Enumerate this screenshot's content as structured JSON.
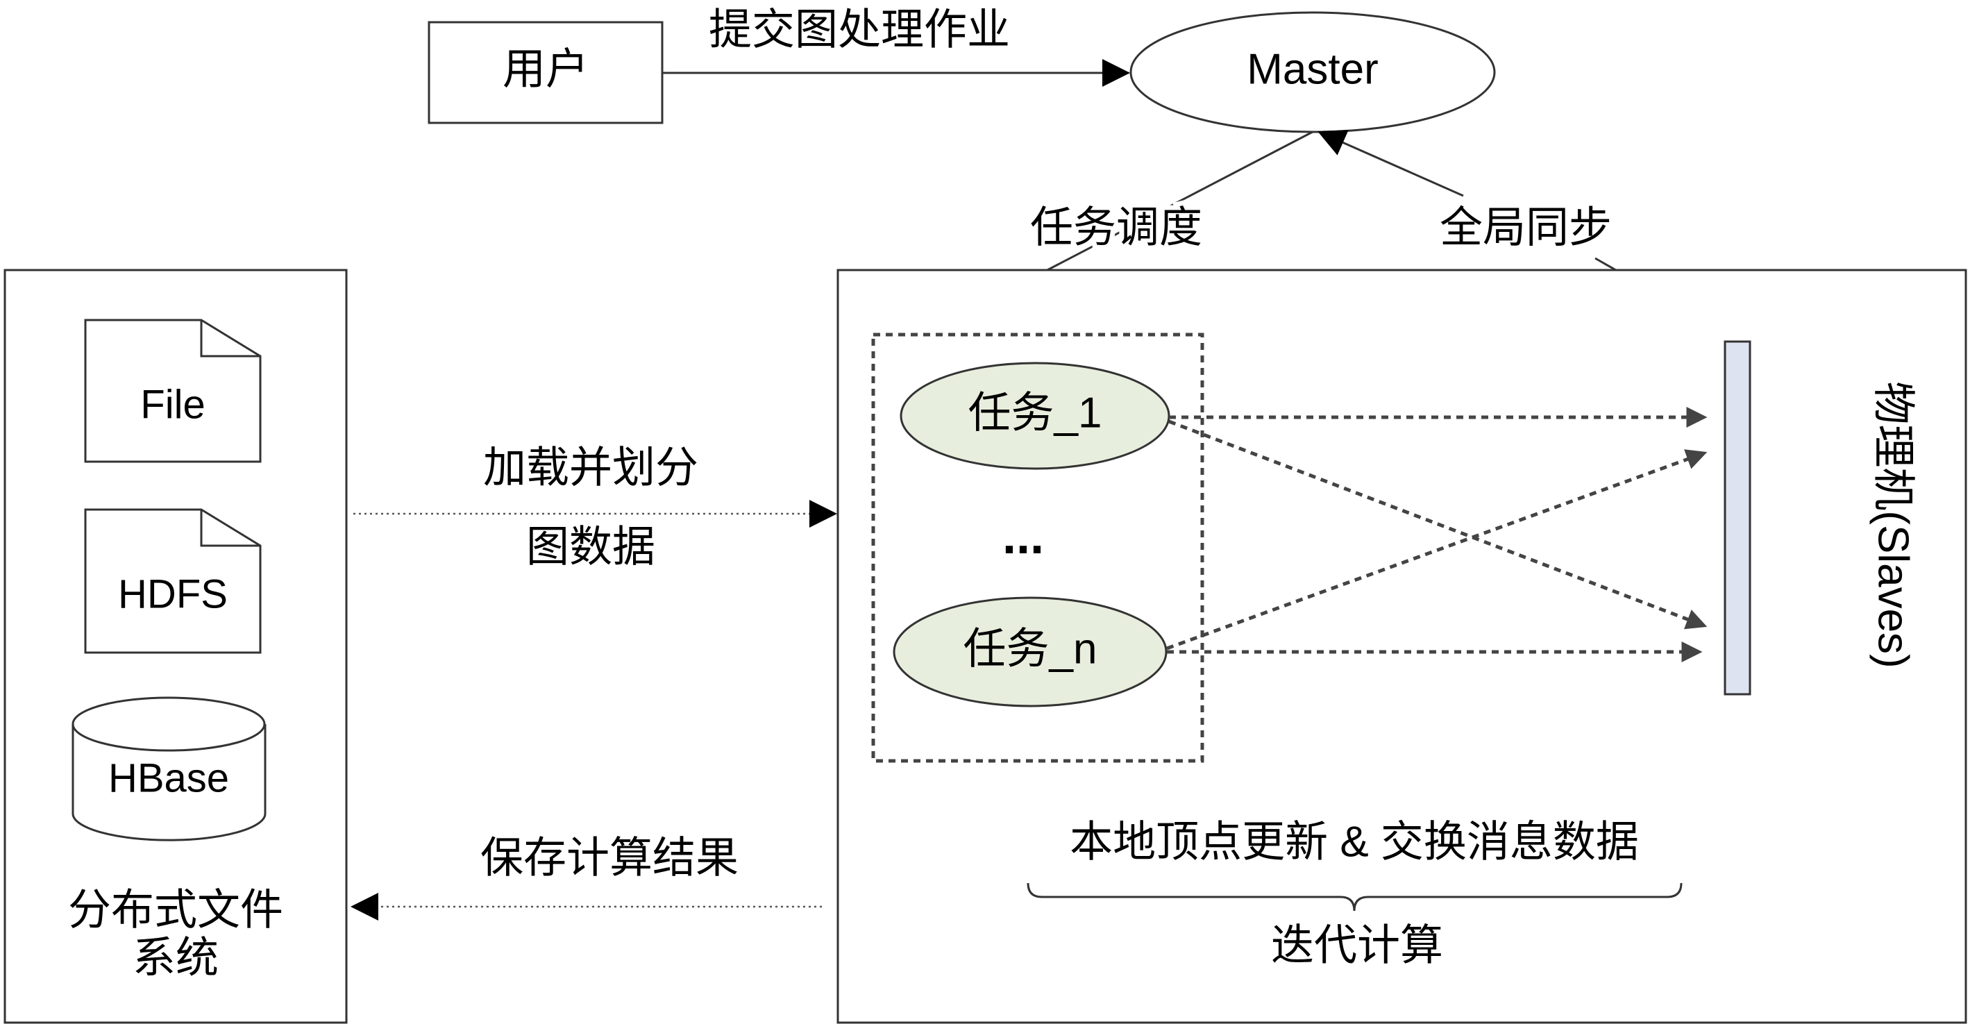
{
  "nodes": {
    "user": "用户",
    "master": "Master",
    "task_1": "任务_1",
    "ellipsis": "...",
    "task_n": "任务_n",
    "file": "File",
    "hdfs": "HDFS",
    "hbase": "HBase",
    "dfs_line1": "分布式文件",
    "dfs_line2": "系统",
    "slaves": "物理机(Slaves)"
  },
  "edges": {
    "submit_job": "提交图处理作业",
    "task_schedule": "任务调度",
    "global_sync": "全局同步",
    "load_line1": "加载并划分",
    "load_line2": "图数据",
    "save_results": "保存计算结果"
  },
  "annotations": {
    "local_update": "本地顶点更新 & 交换消息数据",
    "iterative_compute": "迭代计算"
  },
  "colors": {
    "task_fill": "#e8eedd",
    "slave_bar_fill": "#dde3f0"
  }
}
